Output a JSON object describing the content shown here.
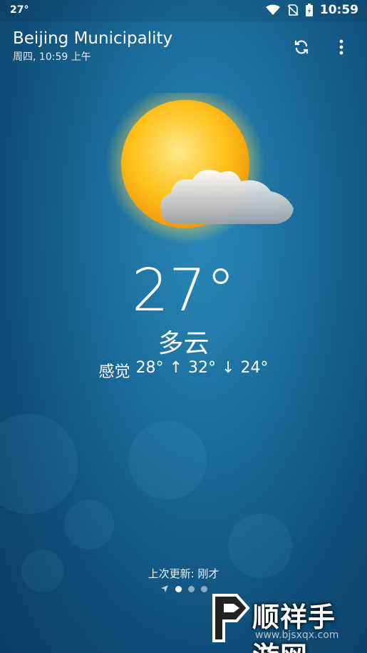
{
  "status": {
    "temp": "27°",
    "time": "10:59"
  },
  "header": {
    "city": "Beijing Municipality",
    "day": "周四,",
    "time": "10:59 上午"
  },
  "weather": {
    "temp": "27°",
    "condition": "多云",
    "feels_label": "感觉",
    "feels": "28°",
    "high": "32°",
    "low": "24°",
    "icon": "partly-cloudy-icon"
  },
  "footer": {
    "updated": "上次更新: 刚才"
  },
  "watermark": {
    "brand": "顺祥手游网",
    "url": "www.bjsxqx.com"
  },
  "colors": {
    "accent_sun": "#f7c21a",
    "background": "#1a6c9c"
  }
}
